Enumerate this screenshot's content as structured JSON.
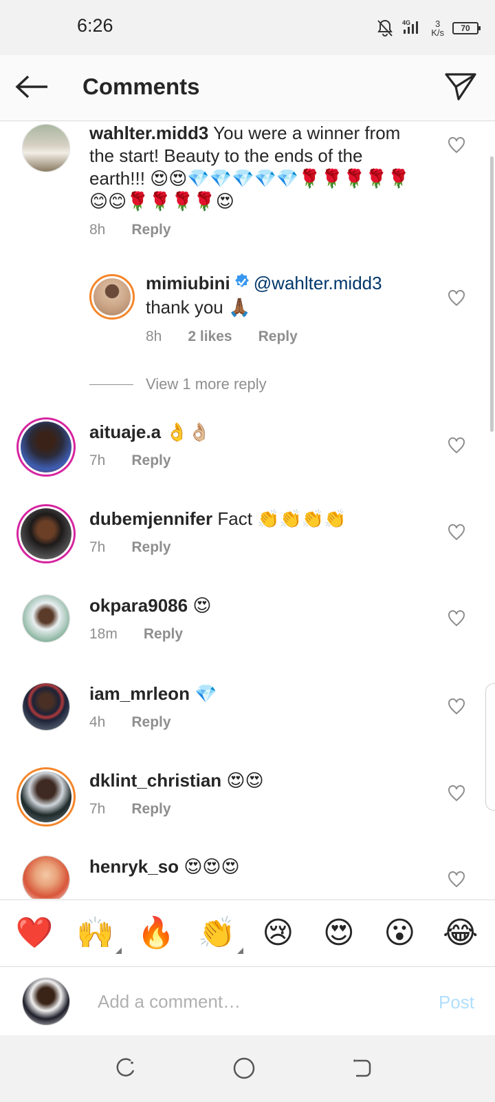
{
  "status_bar": {
    "time": "6:26",
    "network": "4G",
    "speed_value": "3",
    "speed_unit": "K/s",
    "battery": "70"
  },
  "header": {
    "title": "Comments"
  },
  "comments": [
    {
      "username": "wahlter.midd3",
      "text": "You were a winner from the start!  Beauty to the ends of the earth!!! 😍😍💎💎💎💎💎🌹🌹🌹🌹🌹😊😊🌹🌹🌹🌹😍",
      "time": "8h",
      "reply_label": "Reply"
    },
    {
      "username": "mimiubini",
      "mention": "@wahlter.midd3",
      "text": "thank you 🙏🏾",
      "time": "8h",
      "likes": "2 likes",
      "reply_label": "Reply"
    },
    {
      "username": "aituaje.a",
      "text": "👌👌🏼",
      "time": "7h",
      "reply_label": "Reply"
    },
    {
      "username": "dubemjennifer",
      "text": "Fact 👏👏👏👏",
      "time": "7h",
      "reply_label": "Reply"
    },
    {
      "username": "okpara9086",
      "text": "😍",
      "time": "18m",
      "reply_label": "Reply"
    },
    {
      "username": "iam_mrleon",
      "text": "💎",
      "time": "4h",
      "reply_label": "Reply"
    },
    {
      "username": "dklint_christian",
      "text": "😍😍",
      "time": "7h",
      "reply_label": "Reply"
    },
    {
      "username": "henryk_so",
      "text": "😍😍😍",
      "time": "",
      "reply_label": ""
    }
  ],
  "view_more_replies": "View 1 more reply",
  "emoji_bar": [
    "❤️",
    "🙌",
    "🔥",
    "👏",
    "😢",
    "😍",
    "😮",
    "😂"
  ],
  "composer": {
    "placeholder": "Add a comment…",
    "post_label": "Post"
  },
  "icons": {
    "back": "arrow-left-icon",
    "share": "paper-plane-icon",
    "like": "heart-outline-icon",
    "verified": "verified-badge-icon"
  },
  "colors": {
    "accent": "#0095f6",
    "post_disabled": "#b2dffc",
    "meta_gray": "#8e8e8e",
    "mention_blue": "#00376b",
    "story_ring_pink": "#d6249f",
    "story_ring_orange": "#f58529"
  }
}
